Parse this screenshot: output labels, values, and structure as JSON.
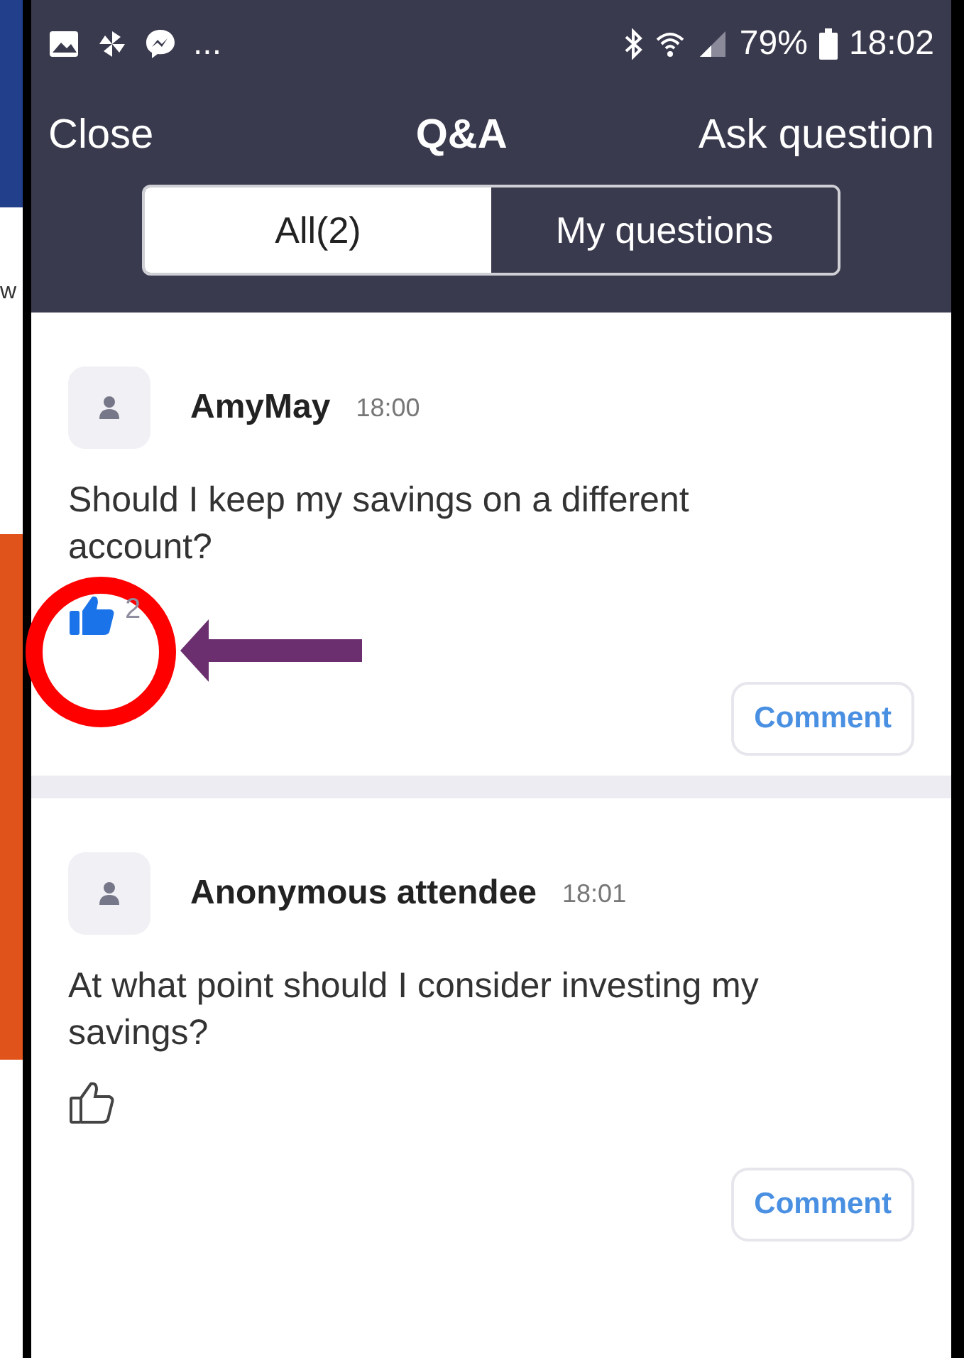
{
  "background": {
    "text_fragment": "w"
  },
  "status_bar": {
    "more": "...",
    "battery": "79%",
    "time": "18:02"
  },
  "header": {
    "close": "Close",
    "title": "Q&A",
    "ask": "Ask question"
  },
  "tabs": [
    {
      "label": "All(2)",
      "selected": true
    },
    {
      "label": "My questions",
      "selected": false
    }
  ],
  "questions": [
    {
      "author": "AmyMay",
      "time": "18:00",
      "text": "Should I keep my savings on a different account?",
      "liked": true,
      "likes": "2",
      "comment": "Comment"
    },
    {
      "author": "Anonymous attendee",
      "time": "18:01",
      "text": "At what point should I consider investing my savings?",
      "liked": false,
      "comment": "Comment"
    }
  ]
}
